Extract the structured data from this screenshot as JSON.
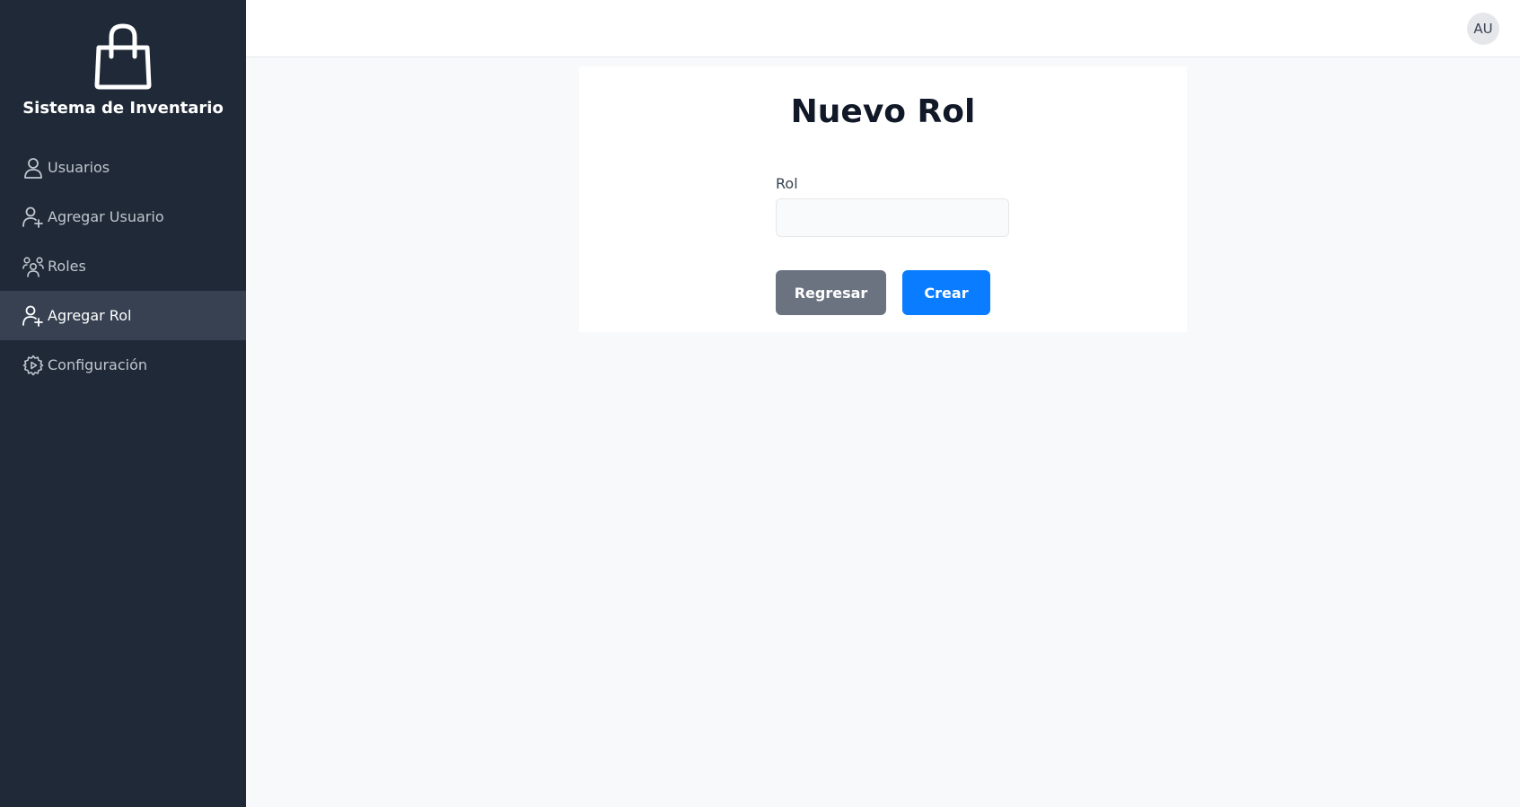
{
  "sidebar": {
    "brand_title": "Sistema de Inventario",
    "brand_icon": "shopping-bag-icon",
    "items": [
      {
        "label": "Usuarios",
        "icon": "user-icon",
        "active": false
      },
      {
        "label": "Agregar Usuario",
        "icon": "user-plus-icon",
        "active": false
      },
      {
        "label": "Roles",
        "icon": "users-group-icon",
        "active": false
      },
      {
        "label": "Agregar Rol",
        "icon": "user-plus-icon",
        "active": true
      },
      {
        "label": "Configuración",
        "icon": "gear-icon",
        "active": false
      }
    ]
  },
  "header": {
    "avatar_initials": "AU"
  },
  "form": {
    "title": "Nuevo Rol",
    "role_label": "Rol",
    "role_value": "",
    "role_placeholder": "",
    "back_label": "Regresar",
    "create_label": "Crear"
  },
  "colors": {
    "sidebar_bg": "#1f2937",
    "sidebar_active_bg": "#374151",
    "primary": "#0a7cff",
    "secondary": "#6b7280",
    "page_bg": "#f8f9fb"
  }
}
